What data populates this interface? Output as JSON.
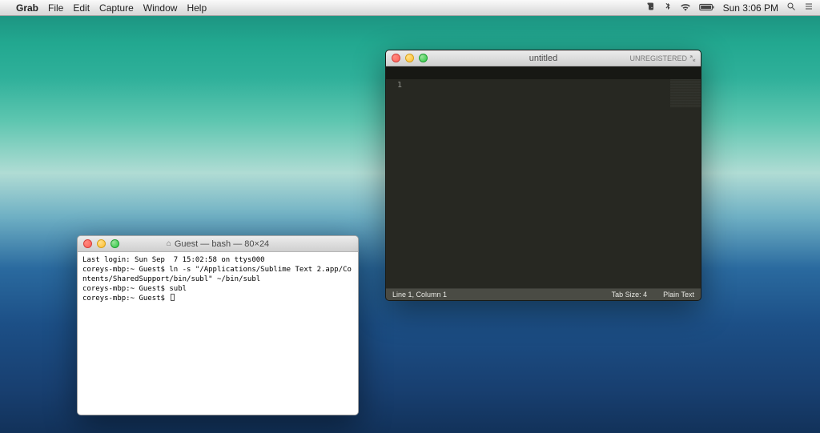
{
  "menubar": {
    "app": "Grab",
    "items": [
      "File",
      "Edit",
      "Capture",
      "Window",
      "Help"
    ],
    "clock": "Sun 3:06 PM",
    "icons": {
      "evernote": "evernote-icon",
      "bluetooth": "bluetooth-icon",
      "wifi": "wifi-icon",
      "battery": "battery-icon",
      "search": "spotlight-icon",
      "notifications": "notification-center-icon"
    }
  },
  "terminal": {
    "title": "Guest — bash — 80×24",
    "lines": [
      "Last login: Sun Sep  7 15:02:58 on ttys000",
      "coreys-mbp:~ Guest$ ln -s \"/Applications/Sublime Text 2.app/Contents/SharedSupport/bin/subl\" ~/bin/subl",
      "coreys-mbp:~ Guest$ subl",
      "coreys-mbp:~ Guest$ "
    ]
  },
  "sublime": {
    "title": "untitled",
    "unregistered": "UNREGISTERED",
    "gutter_line": "1",
    "status_left": "Line 1, Column 1",
    "status_tab": "Tab Size: 4",
    "status_syntax": "Plain Text"
  }
}
